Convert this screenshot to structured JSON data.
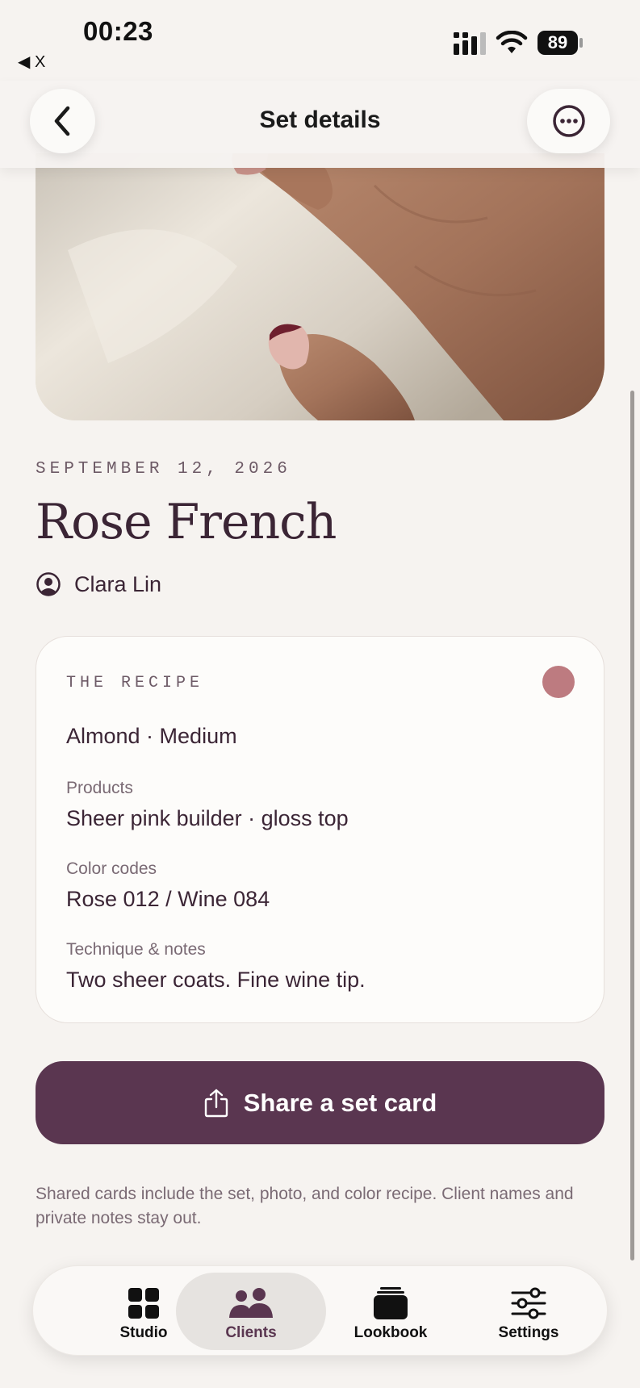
{
  "status_bar": {
    "time": "00:23",
    "back_app": "◀ X",
    "battery": "89"
  },
  "nav": {
    "title": "Set details"
  },
  "set": {
    "date": "SEPTEMBER 12, 2026",
    "title": "Rose French",
    "client": "Clara Lin"
  },
  "recipe": {
    "label": "THE RECIPE",
    "swatch_color": "#bd7b80",
    "shape_length": "Almond · Medium",
    "fields": [
      {
        "label": "Products",
        "value": "Sheer pink builder · gloss top"
      },
      {
        "label": "Color codes",
        "value": "Rose 012 / Wine 084"
      },
      {
        "label": "Technique & notes",
        "value": "Two sheer coats. Fine wine tip."
      }
    ]
  },
  "share": {
    "label": "Share a set card"
  },
  "footnote": "Shared cards include the set, photo, and color recipe. Client names and private notes stay out.",
  "tabs": [
    {
      "label": "Studio",
      "icon": "grid-icon",
      "active": false
    },
    {
      "label": "Clients",
      "icon": "people-icon",
      "active": true
    },
    {
      "label": "Lookbook",
      "icon": "stack-icon",
      "active": false
    },
    {
      "label": "Settings",
      "icon": "sliders-icon",
      "active": false
    }
  ],
  "colors": {
    "accent": "#5a3650",
    "background": "#f6f3f0",
    "text": "#3b2535"
  }
}
